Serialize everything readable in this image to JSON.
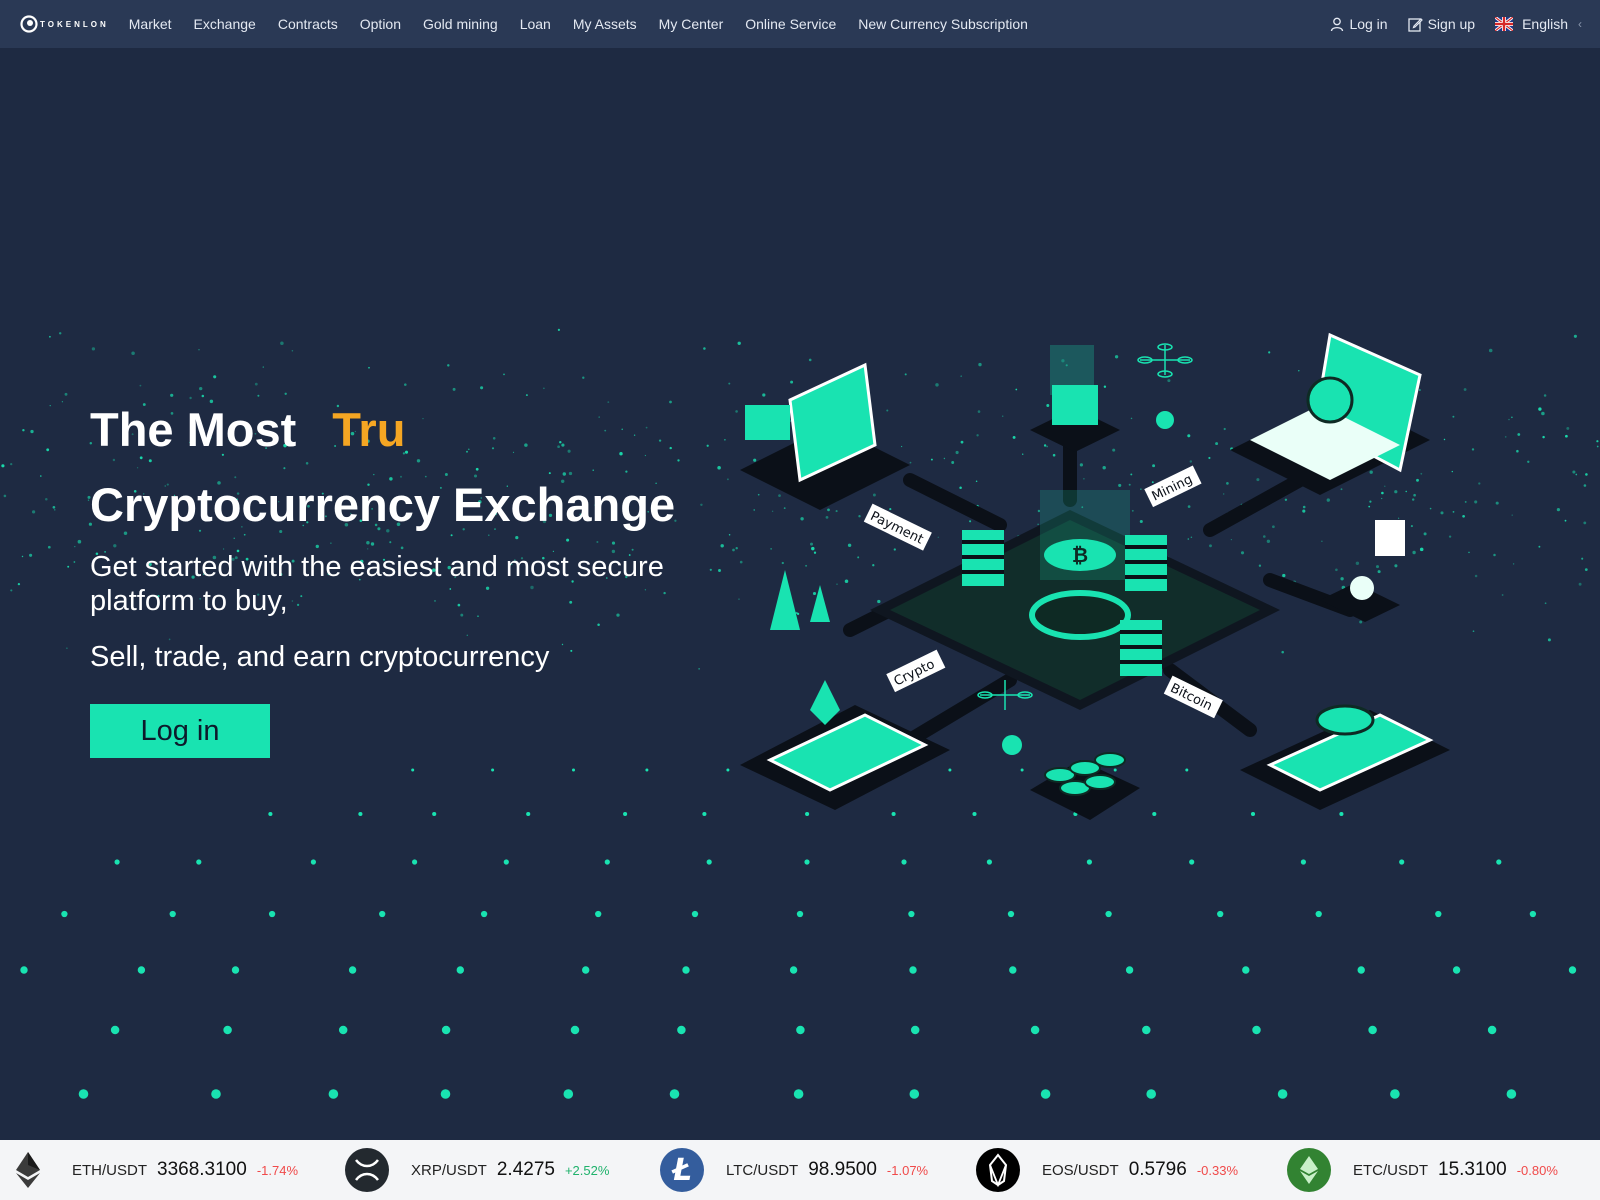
{
  "brand": {
    "logo_text": "TOKENLON"
  },
  "nav": {
    "links": [
      "Market",
      "Exchange",
      "Contracts",
      "Option",
      "Gold mining",
      "Loan",
      "My Assets",
      "My Center",
      "Online Service",
      "New Currency Subscription"
    ],
    "login": "Log in",
    "signup": "Sign up",
    "language": "English"
  },
  "hero": {
    "title_line1": "The Most",
    "title_accent": "Tru",
    "title_line2": "Cryptocurrency Exchange",
    "subtitle1": "Get started with the easiest and most secure platform to buy,",
    "subtitle2": "Sell, trade, and earn cryptocurrency",
    "cta": "Log in"
  },
  "illustration_labels": [
    "Payment",
    "Mining",
    "Crypto",
    "Bitcoin"
  ],
  "ticker": [
    {
      "pair": "ETH/USDT",
      "price": "3368.3100",
      "change": "-1.74%",
      "direction": "down",
      "icon": "ethereum-icon"
    },
    {
      "pair": "XRP/USDT",
      "price": "2.4275",
      "change": "+2.52%",
      "direction": "up",
      "icon": "xrp-icon"
    },
    {
      "pair": "LTC/USDT",
      "price": "98.9500",
      "change": "-1.07%",
      "direction": "down",
      "icon": "litecoin-icon"
    },
    {
      "pair": "EOS/USDT",
      "price": "0.5796",
      "change": "-0.33%",
      "direction": "down",
      "icon": "eos-icon"
    },
    {
      "pair": "ETC/USDT",
      "price": "15.3100",
      "change": "-0.80%",
      "direction": "down",
      "icon": "ethereum-classic-icon"
    }
  ],
  "colors": {
    "background": "#1e2a42",
    "nav_background": "#2a3955",
    "accent_teal": "#19e3b1",
    "accent_orange": "#f5a623",
    "down": "#f04a4a",
    "up": "#20b26c"
  }
}
